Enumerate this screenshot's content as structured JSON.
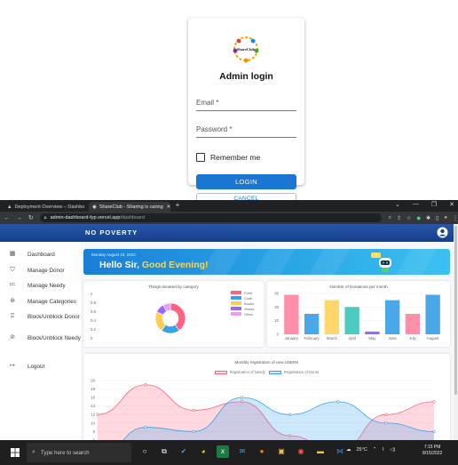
{
  "login": {
    "logo_text": "ShareClub",
    "title": "Admin login",
    "email_placeholder": "Email *",
    "password_placeholder": "Password *",
    "remember_label": "Remember me",
    "login_button": "LOGIN",
    "cancel_button": "CANCEL"
  },
  "browser": {
    "tabs": [
      {
        "label": "Deployment Overview – Dashbo"
      },
      {
        "label": "ShareClub - Sharing is caring"
      }
    ],
    "url_host": "admin-dashboard-fyp.vercel.app",
    "url_path": "/dashboard"
  },
  "app": {
    "brand": "NO POVERTY",
    "sidebar": [
      {
        "icon": "dashboard-icon",
        "label": "Dashboard"
      },
      {
        "icon": "shield-icon",
        "label": "Manage Donor"
      },
      {
        "icon": "list-icon",
        "label": "Manage Needy"
      },
      {
        "icon": "categories-icon",
        "label": "Manage Categories"
      },
      {
        "icon": "block-user-icon",
        "label": "Block/Unblock Donor"
      },
      {
        "icon": "block-icon",
        "label": "Block/Unblock Needy"
      },
      {
        "icon": "logout-icon",
        "label": "Logout"
      }
    ],
    "banner": {
      "date": "Monday August 15, 2022",
      "greeting_prefix": "Hello Sir, ",
      "greeting_accent": "Good Evening!"
    }
  },
  "chart_data": [
    {
      "type": "pie",
      "title": "Things donated by category",
      "categories": [
        "Food",
        "Cloth",
        "Books",
        "Shoes",
        "Other"
      ],
      "values": [
        40,
        20,
        22,
        10,
        8
      ],
      "colors": [
        "#ff6384",
        "#36a2eb",
        "#ffcd56",
        "#9966ff",
        "#e8a0f0"
      ],
      "y_ticks": [
        "1",
        "0.8",
        "0.6",
        "0.4",
        "0.2",
        "0"
      ]
    },
    {
      "type": "bar",
      "title": "Number of Donations per month",
      "categories": [
        "January",
        "February",
        "March",
        "April",
        "May",
        "June",
        "July",
        "August"
      ],
      "values": [
        29,
        15,
        25,
        20,
        2,
        25,
        15,
        29
      ],
      "colors": [
        "#ff8fa8",
        "#4aa8e8",
        "#ffd66b",
        "#4ccbc0",
        "#9966ff",
        "#4aa8e8",
        "#ff8fa8",
        "#4aa8e8"
      ],
      "ylim": [
        0,
        30
      ],
      "y_ticks": [
        0,
        10,
        20,
        30
      ]
    },
    {
      "type": "area",
      "title": "Monthly registration of new USERS",
      "y_ticks": [
        2,
        4,
        6,
        8,
        10,
        12,
        14,
        16,
        18,
        20
      ],
      "series": [
        {
          "name": "Registration of Needy",
          "color": "#ff6384",
          "fill": "rgba(255,99,132,0.25)",
          "values": [
            12,
            19,
            13,
            15,
            7,
            3,
            12,
            15
          ]
        },
        {
          "name": "Registration of Donor",
          "color": "#36a2eb",
          "fill": "rgba(54,162,235,0.25)",
          "values": [
            2,
            9,
            8,
            16,
            12,
            15,
            10,
            8
          ]
        }
      ]
    }
  ],
  "taskbar": {
    "search_placeholder": "Type here to search",
    "weather": "25°C",
    "time": "7:15 PM",
    "date": "8/15/2022"
  }
}
